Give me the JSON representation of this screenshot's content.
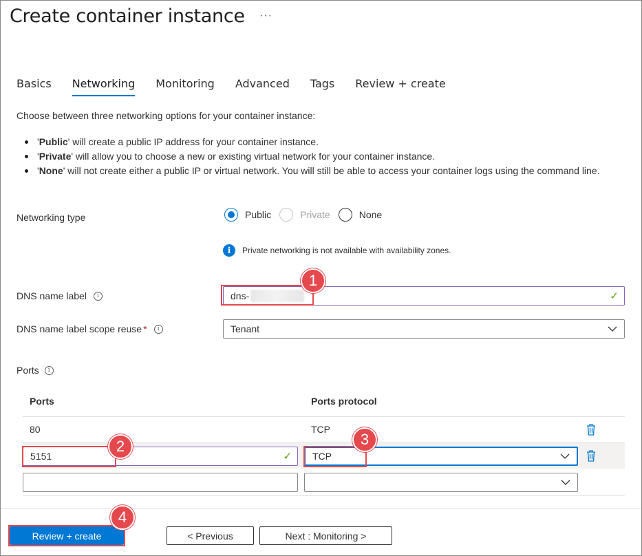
{
  "header": {
    "title": "Create container instance",
    "more_label": "···"
  },
  "tabs": [
    {
      "label": "Basics",
      "active": false
    },
    {
      "label": "Networking",
      "active": true
    },
    {
      "label": "Monitoring",
      "active": false
    },
    {
      "label": "Advanced",
      "active": false
    },
    {
      "label": "Tags",
      "active": false
    },
    {
      "label": "Review + create",
      "active": false
    }
  ],
  "intro": "Choose between three networking options for your container instance:",
  "bullets": [
    {
      "pre": "'",
      "bold": "Public",
      "post": "' will create a public IP address for your container instance."
    },
    {
      "pre": "'",
      "bold": "Private",
      "post": "' will allow you to choose a new or existing virtual network for your container instance."
    },
    {
      "pre": "'",
      "bold": "None",
      "post": "' will not create either a public IP or virtual network. You will still be able to access your container logs using the command line."
    }
  ],
  "networking_type": {
    "label": "Networking type",
    "options": [
      {
        "label": "Public",
        "checked": true,
        "disabled": false
      },
      {
        "label": "Private",
        "checked": false,
        "disabled": true
      },
      {
        "label": "None",
        "checked": false,
        "disabled": false
      }
    ],
    "note": "Private networking is not available with availability zones.",
    "note_icon": "info-icon"
  },
  "dns_label": {
    "label": "DNS name label",
    "value": "dns-",
    "valid": true
  },
  "dns_scope": {
    "label": "DNS name label scope reuse",
    "required_mark": "*",
    "value": "Tenant"
  },
  "ports_section": {
    "label": "Ports",
    "col_ports": "Ports",
    "col_protocol": "Ports protocol",
    "rows": [
      {
        "port": "80",
        "protocol": "TCP"
      },
      {
        "port": "5151",
        "protocol": "TCP"
      },
      {
        "port": "",
        "protocol": ""
      }
    ]
  },
  "footer": {
    "review_create": "Review + create",
    "previous": "< Previous",
    "next": "Next : Monitoring >"
  },
  "callouts": [
    "1",
    "2",
    "3",
    "4"
  ],
  "colors": {
    "accent": "#0078d4",
    "callout": "#e5484d",
    "valid": "#57a300"
  }
}
